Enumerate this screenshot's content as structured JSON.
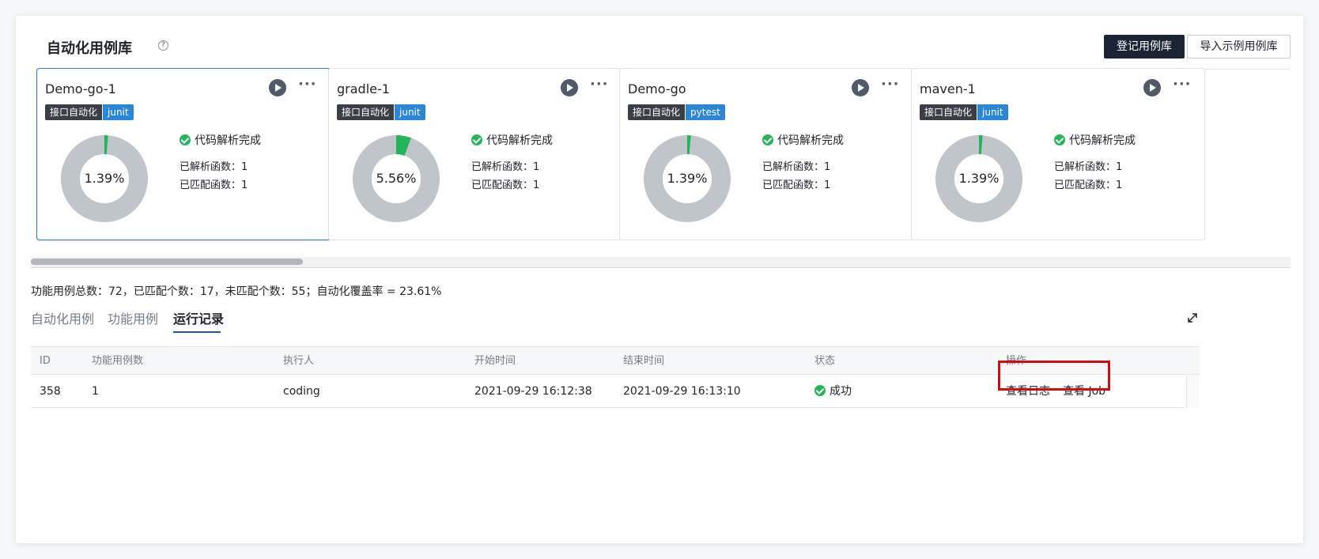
{
  "header": {
    "title": "自动化用例库",
    "help_glyph": "?",
    "primary_button": "登记用例库",
    "secondary_button": "导入示例用例库"
  },
  "cards": [
    {
      "name": "Demo-go-1",
      "tag_type": "接口自动化",
      "tag_lang": "junit",
      "percent": 1.39,
      "percent_label": "1.39%",
      "status": "代码解析完成",
      "parsed": "已解析函数：1",
      "matched": "已匹配函数：1"
    },
    {
      "name": "gradle-1",
      "tag_type": "接口自动化",
      "tag_lang": "junit",
      "percent": 5.56,
      "percent_label": "5.56%",
      "status": "代码解析完成",
      "parsed": "已解析函数：1",
      "matched": "已匹配函数：1"
    },
    {
      "name": "Demo-go",
      "tag_type": "接口自动化",
      "tag_lang": "pytest",
      "percent": 1.39,
      "percent_label": "1.39%",
      "status": "代码解析完成",
      "parsed": "已解析函数：1",
      "matched": "已匹配函数：1"
    },
    {
      "name": "maven-1",
      "tag_type": "接口自动化",
      "tag_lang": "junit",
      "percent": 1.39,
      "percent_label": "1.39%",
      "status": "代码解析完成",
      "parsed": "已解析函数：1",
      "matched": "已匹配函数：1"
    }
  ],
  "colors": {
    "donut_track": "#c0c4cb",
    "donut_fill": "#25b45a",
    "accent": "#2f4bb8",
    "success": "#25b45a",
    "highlight": "#d20a12"
  },
  "summary": "功能用例总数：72，已匹配个数：17，未匹配个数：55；自动化覆盖率 = 23.61%",
  "tabs": [
    {
      "label": "自动化用例",
      "active": false
    },
    {
      "label": "功能用例",
      "active": false
    },
    {
      "label": "运行记录",
      "active": true
    }
  ],
  "table": {
    "columns": [
      "ID",
      "功能用例数",
      "执行人",
      "开始时间",
      "结束时间",
      "状态",
      "操作"
    ],
    "rows": [
      {
        "id": "358",
        "case_count": "1",
        "executor": "coding",
        "start": "2021-09-29 16:12:38",
        "end": "2021-09-29 16:13:10",
        "status": "成功",
        "op_log": "查看日志",
        "op_job": "查看 Job"
      }
    ]
  }
}
